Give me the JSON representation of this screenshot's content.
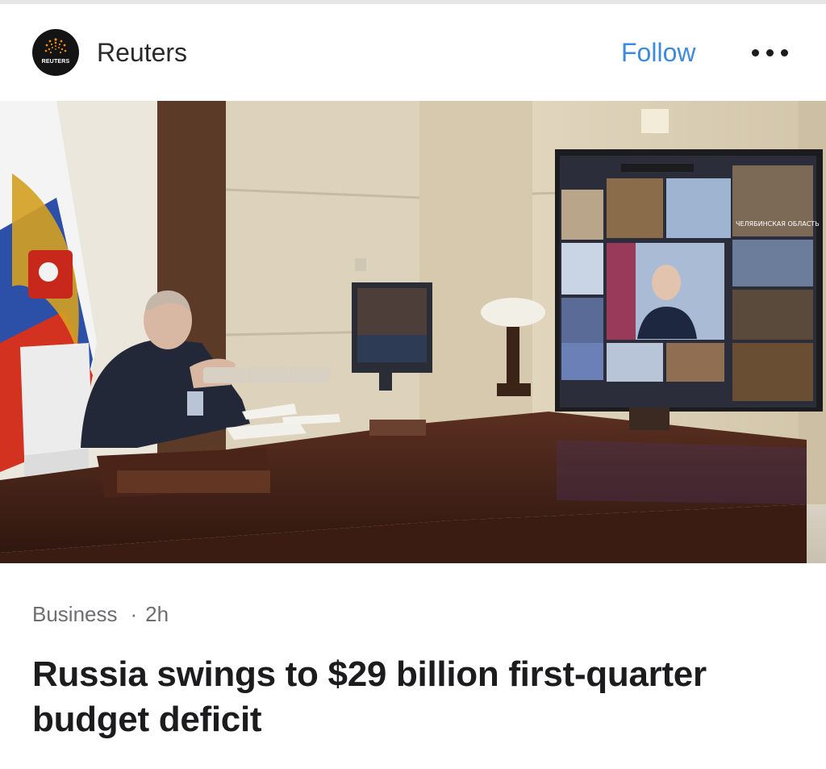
{
  "header": {
    "logo_text": "REUTERS",
    "publisher": "Reuters",
    "follow_label": "Follow",
    "more_icon": "more-horizontal-icon"
  },
  "hero_image": {
    "screen_labels": [
      "ЧЕЛЯБИНСКАЯ ОБЛАСТЬ"
    ]
  },
  "article": {
    "category": "Business",
    "separator": "·",
    "age": "2h",
    "headline": "Russia swings to $29 billion first-quarter budget deficit"
  },
  "colors": {
    "accent": "#3d8ae0",
    "text": "#1c1c1e",
    "meta": "#6d6d72"
  }
}
